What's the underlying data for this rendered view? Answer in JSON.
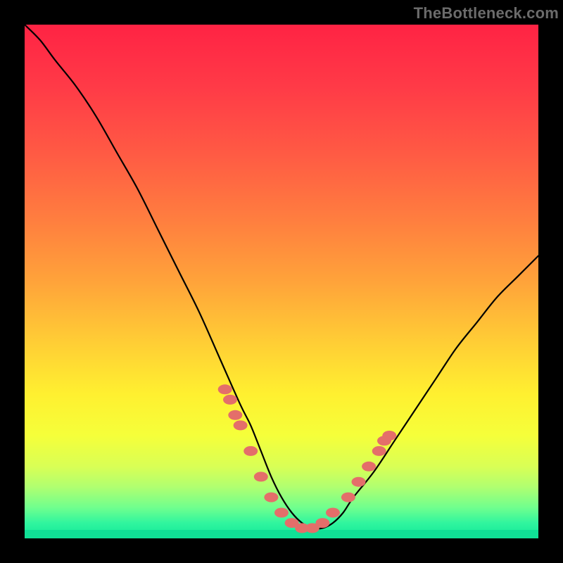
{
  "watermark": "TheBottleneck.com",
  "colors": {
    "page_bg": "#000000",
    "curve": "#000000",
    "marker_fill": "#e46e6a",
    "marker_stroke": "#c94f4b",
    "gradient_stops": [
      {
        "offset": 0.0,
        "color": "#ff2344"
      },
      {
        "offset": 0.12,
        "color": "#ff3a47"
      },
      {
        "offset": 0.25,
        "color": "#ff5a44"
      },
      {
        "offset": 0.38,
        "color": "#ff7e3f"
      },
      {
        "offset": 0.5,
        "color": "#ffa33a"
      },
      {
        "offset": 0.62,
        "color": "#ffce35"
      },
      {
        "offset": 0.72,
        "color": "#fff030"
      },
      {
        "offset": 0.8,
        "color": "#f5ff3a"
      },
      {
        "offset": 0.86,
        "color": "#d9ff55"
      },
      {
        "offset": 0.9,
        "color": "#b0ff70"
      },
      {
        "offset": 0.94,
        "color": "#70ff8e"
      },
      {
        "offset": 0.97,
        "color": "#30f59e"
      },
      {
        "offset": 1.0,
        "color": "#10e89a"
      }
    ],
    "bottom_band_top": "#11ffa2",
    "bottom_band_bot": "#0fd892"
  },
  "chart_data": {
    "type": "line",
    "title": "",
    "xlabel": "",
    "ylabel": "",
    "xlim": [
      0,
      100
    ],
    "ylim": [
      0,
      100
    ],
    "grid": false,
    "legend": false,
    "series": [
      {
        "name": "bottleneck-curve",
        "x": [
          0,
          3,
          6,
          10,
          14,
          18,
          22,
          26,
          30,
          34,
          38,
          42,
          44,
          46,
          48,
          50,
          52,
          54,
          56,
          58,
          60,
          62,
          64,
          68,
          72,
          76,
          80,
          84,
          88,
          92,
          96,
          100
        ],
        "y": [
          100,
          97,
          93,
          88,
          82,
          75,
          68,
          60,
          52,
          44,
          35,
          26,
          22,
          17,
          12,
          8,
          5,
          3,
          2,
          2,
          3,
          5,
          8,
          13,
          19,
          25,
          31,
          37,
          42,
          47,
          51,
          55
        ]
      }
    ],
    "markers": {
      "name": "salmon-dots",
      "x": [
        39,
        40,
        41,
        42,
        44,
        46,
        48,
        50,
        52,
        54,
        56,
        58,
        60,
        63,
        65,
        67,
        69,
        70,
        71
      ],
      "y": [
        29,
        27,
        24,
        22,
        17,
        12,
        8,
        5,
        3,
        2,
        2,
        3,
        5,
        8,
        11,
        14,
        17,
        19,
        20
      ]
    },
    "notes": "Values are read from the rendered curve relative to the plot box; x is percent across, y is percent of vertical span above the baseline. 0,0 is bottom-left."
  }
}
